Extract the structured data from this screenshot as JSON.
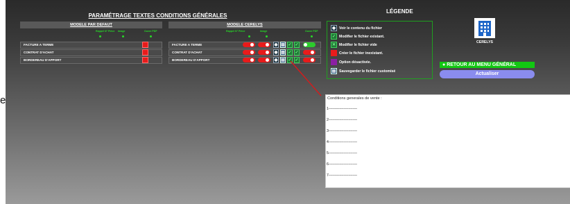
{
  "edge_glyph": "e",
  "title": "PARAMÉTRAGE TEXTES CONDITIONS GÉNÉRALES",
  "default_model": {
    "header": "MODELE PAR DEFAUT",
    "subheads": [
      "Rappel N° Pièce",
      "Image",
      "Ouvre PDF"
    ],
    "rows": [
      "FACTURE A TERME",
      "CONTRAT D'ACHAT",
      "BORDEREAU D'APPORT"
    ]
  },
  "cerelys_model": {
    "header": "MODELE CERELYS",
    "subheads": [
      "Rappel N° Pièce",
      "Image",
      "Ouvre PDF"
    ],
    "rows": [
      "FACTURE A TERME",
      "CONTRAT D'ACHAT",
      "BORDEREAU D'APPORT"
    ]
  },
  "legend": {
    "title": "LÉGENDE",
    "items": [
      {
        "label": "Voir le contenu du fichier",
        "icon": "eye-icon",
        "color": "#0e2733"
      },
      {
        "label": "Modifier le fichier existant.",
        "icon": "check-icon",
        "color": "#207a37"
      },
      {
        "label": "Modifier le fichier vide",
        "icon": "x-icon",
        "color": "#207a37"
      },
      {
        "label": "Créer le fichier inexistant.",
        "icon": "red-square",
        "color": "#e81b1b"
      },
      {
        "label": "Option désactivée.",
        "icon": "purple-square",
        "color": "#8b1fa3"
      },
      {
        "label": "Sauvegarder le fichier customisé",
        "icon": "save-icon",
        "color": "#2b4f7a"
      }
    ]
  },
  "company": "CERELYS",
  "buttons": {
    "retour": "RETOUR AU MENU GÉNÉRAL",
    "actualiser": "Actualiser"
  },
  "document": {
    "title": "Conditions generales de vente :",
    "lines": [
      "1---------------------------",
      "2---------------------------",
      "3---------------------------",
      "4---------------------------",
      "5---------------------------",
      "6---------------------------",
      "7---------------------------"
    ]
  },
  "colors": {
    "accent_green": "#12c712",
    "status_red": "#e81b1b",
    "button_purple": "#8a8cee"
  }
}
